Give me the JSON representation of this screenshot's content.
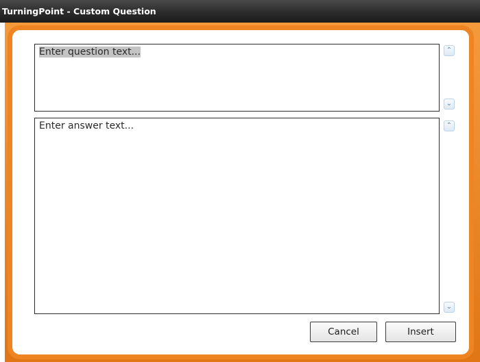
{
  "window": {
    "title": "TurningPoint - Custom Question"
  },
  "question": {
    "text": "Enter question text..."
  },
  "answer": {
    "text": "Enter answer text..."
  },
  "scroll": {
    "up_glyph": "⌃",
    "down_glyph": "⌄"
  },
  "buttons": {
    "cancel_label": "Cancel",
    "insert_label": "Insert"
  },
  "colors": {
    "accent_orange": "#ee8422",
    "titlebar": "#2b2b2b",
    "selection_highlight": "#c4c4c4"
  }
}
